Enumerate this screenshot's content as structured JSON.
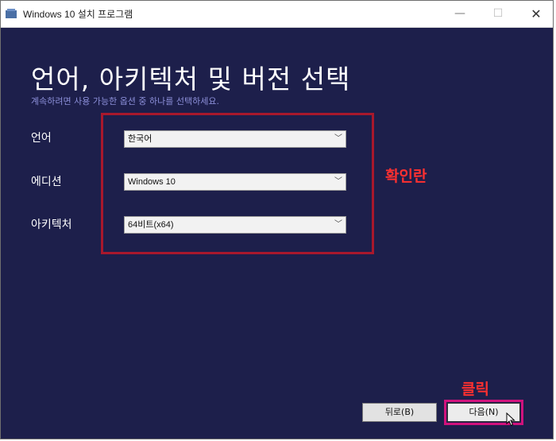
{
  "window": {
    "title": "Windows 10 설치 프로그램"
  },
  "controls": {
    "minimize": "—",
    "maximize": "☐",
    "close": "✕"
  },
  "page": {
    "heading": "언어, 아키텍처 및 버전 선택",
    "subtitle": "계속하려면 사용 가능한 옵션 중 하나를 선택하세요."
  },
  "fields": [
    {
      "label": "언어",
      "value": "한국어"
    },
    {
      "label": "에디션",
      "value": "Windows 10"
    },
    {
      "label": "아키텍처",
      "value": "64비트(x64)"
    }
  ],
  "annotations": {
    "check": "확인란",
    "click": "클릭"
  },
  "buttons": {
    "back": "뒤로(B)",
    "next": "다음(N)"
  },
  "colors": {
    "background": "#1d1f4b",
    "highlight_box": "#a8182c",
    "next_highlight": "#d0127c",
    "annotation_text": "#ff3030"
  },
  "icons": {
    "app": "window-icon",
    "chevron": "chevron-down-icon",
    "cursor": "mouse-cursor-icon"
  }
}
